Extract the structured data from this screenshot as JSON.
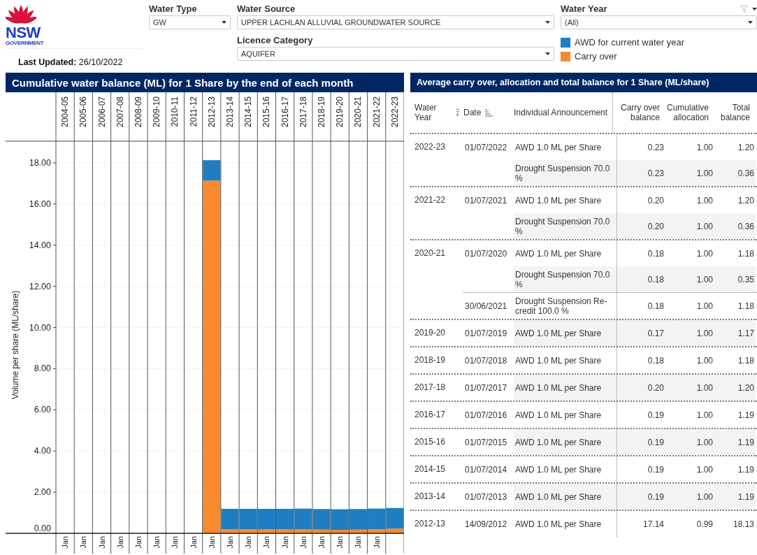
{
  "header": {
    "logo": {
      "wordmark": "NSW",
      "subtitle": "GOVERNMENT"
    },
    "last_updated": {
      "label": "Last Updated:",
      "value": "26/10/2022"
    }
  },
  "filter_columns": [
    [
      {
        "label": "Water Type",
        "value": "GW"
      }
    ],
    [
      {
        "label": "Water Source",
        "value": "UPPER LACHLAN ALLUVIAL GROUNDWATER SOURCE"
      },
      {
        "label": "Licence Category",
        "value": "AQUIFER"
      }
    ],
    [
      {
        "label": "Water Year",
        "value": "(All)"
      }
    ]
  ],
  "chart_panel": {
    "title": "Cumulative water balance (ML) for 1 Share by the end of each month",
    "month_labels": [
      "Jan",
      "Jan",
      "Jan",
      "Jan",
      "Jan",
      "Jan",
      "Jan",
      "Jan",
      "Jan",
      "Jan",
      "Jan",
      "Jan",
      "Jan",
      "Jan",
      "Jan",
      "Jan",
      "Jan",
      "Jan"
    ],
    "chart_data": {
      "type": "bar",
      "stacked": true,
      "grid": true,
      "ylabel": "Volume per share (ML/share)",
      "ylim": [
        0,
        21.43
      ],
      "categories": [
        "2004-05",
        "2005-06",
        "2006-07",
        "2007-08",
        "2008-09",
        "2009-10",
        "2010-11",
        "2011-12",
        "2012-13",
        "2013-14",
        "2014-15",
        "2015-16",
        "2016-17",
        "2017-18",
        "2018-19",
        "2019-20",
        "2020-21",
        "2021-22",
        "2022-23"
      ],
      "yticks": [
        {
          "value": 0,
          "label": "0.00"
        },
        {
          "value": 2,
          "label": "2.00"
        },
        {
          "value": 4,
          "label": "4.00"
        },
        {
          "value": 6,
          "label": "6.00"
        },
        {
          "value": 8,
          "label": "8.00"
        },
        {
          "value": 10,
          "label": "10.00"
        },
        {
          "value": 12,
          "label": "12.00"
        },
        {
          "value": 14,
          "label": "14.00"
        },
        {
          "value": 16,
          "label": "16.00"
        },
        {
          "value": 18,
          "label": "18.00"
        }
      ],
      "series": [
        {
          "name": "Carry over",
          "color": "#f7892f",
          "values": [
            null,
            null,
            null,
            null,
            null,
            null,
            null,
            null,
            17.14,
            0.19,
            0.19,
            0.19,
            0.19,
            0.2,
            0.18,
            0.17,
            0.18,
            0.2,
            0.23
          ]
        },
        {
          "name": "AWD for current water year",
          "color": "#1f7ec1",
          "values": [
            null,
            null,
            null,
            null,
            null,
            null,
            null,
            null,
            0.99,
            1.0,
            1.0,
            1.0,
            1.0,
            1.0,
            1.0,
            1.0,
            1.0,
            1.0,
            1.0
          ]
        }
      ]
    }
  },
  "table_panel": {
    "title": "Average carry over, allocation and total balance for 1 Share (ML/share)",
    "columns": [
      {
        "label": "Water Year",
        "sortable": true
      },
      {
        "label": "Date",
        "sortable": true
      },
      {
        "label": "Individual Announcement",
        "sortable": false
      },
      {
        "label": "Carry over balance",
        "sortable": false
      },
      {
        "label": "Cumulative allocation",
        "sortable": false
      },
      {
        "label": "Total balance",
        "sortable": false
      }
    ],
    "groups": [
      {
        "water_year": "2022-23",
        "entries": [
          {
            "date": "01/07/2022",
            "announcement": "AWD 1.0 ML per Share",
            "carry_over": "0.23",
            "cumulative_allocation": "1.00",
            "total_balance": "1.20"
          },
          {
            "announcement": "Drought Suspension 70.0 %",
            "carry_over": "0.23",
            "cumulative_allocation": "1.00",
            "total_balance": "0.36"
          }
        ]
      },
      {
        "water_year": "2021-22",
        "entries": [
          {
            "date": "01/07/2021",
            "announcement": "AWD 1.0 ML per Share",
            "carry_over": "0.20",
            "cumulative_allocation": "1.00",
            "total_balance": "1.20"
          },
          {
            "announcement": "Drought Suspension 70.0 %",
            "carry_over": "0.20",
            "cumulative_allocation": "1.00",
            "total_balance": "0.36"
          }
        ]
      },
      {
        "water_year": "2020-21",
        "entries": [
          {
            "date": "01/07/2020",
            "announcement": "AWD 1.0 ML per Share",
            "carry_over": "0.18",
            "cumulative_allocation": "1.00",
            "total_balance": "1.18"
          },
          {
            "announcement": "Drought Suspension 70.0 %",
            "carry_over": "0.18",
            "cumulative_allocation": "1.00",
            "total_balance": "0.35"
          },
          {
            "date": "30/06/2021",
            "announcement": "Drought Suspension Re-credit 100.0 %",
            "carry_over": "0.18",
            "cumulative_allocation": "1.00",
            "total_balance": "1.18"
          }
        ]
      },
      {
        "water_year": "2019-20",
        "entries": [
          {
            "date": "01/07/2019",
            "announcement": "AWD 1.0 ML per Share",
            "carry_over": "0.17",
            "cumulative_allocation": "1.00",
            "total_balance": "1.17"
          }
        ]
      },
      {
        "water_year": "2018-19",
        "entries": [
          {
            "date": "01/07/2018",
            "announcement": "AWD 1.0 ML per Share",
            "carry_over": "0.18",
            "cumulative_allocation": "1.00",
            "total_balance": "1.18"
          }
        ]
      },
      {
        "water_year": "2017-18",
        "entries": [
          {
            "date": "01/07/2017",
            "announcement": "AWD 1.0 ML per Share",
            "carry_over": "0.20",
            "cumulative_allocation": "1.00",
            "total_balance": "1.20"
          }
        ]
      },
      {
        "water_year": "2016-17",
        "entries": [
          {
            "date": "01/07/2016",
            "announcement": "AWD 1.0 ML per Share",
            "carry_over": "0.19",
            "cumulative_allocation": "1.00",
            "total_balance": "1.19"
          }
        ]
      },
      {
        "water_year": "2015-16",
        "entries": [
          {
            "date": "01/07/2015",
            "announcement": "AWD 1.0 ML per Share",
            "carry_over": "0.19",
            "cumulative_allocation": "1.00",
            "total_balance": "1.19"
          }
        ]
      },
      {
        "water_year": "2014-15",
        "entries": [
          {
            "date": "01/07/2014",
            "announcement": "AWD 1.0 ML per Share",
            "carry_over": "0.19",
            "cumulative_allocation": "1.00",
            "total_balance": "1.19"
          }
        ]
      },
      {
        "water_year": "2013-14",
        "entries": [
          {
            "date": "01/07/2013",
            "announcement": "AWD 1.0 ML per Share",
            "carry_over": "0.19",
            "cumulative_allocation": "1.00",
            "total_balance": "1.19"
          }
        ]
      },
      {
        "water_year": "2012-13",
        "entries": [
          {
            "date": "14/09/2012",
            "announcement": "AWD 1.0 ML per Share",
            "carry_over": "17.14",
            "cumulative_allocation": "0.99",
            "total_balance": "18.13"
          }
        ]
      }
    ]
  }
}
